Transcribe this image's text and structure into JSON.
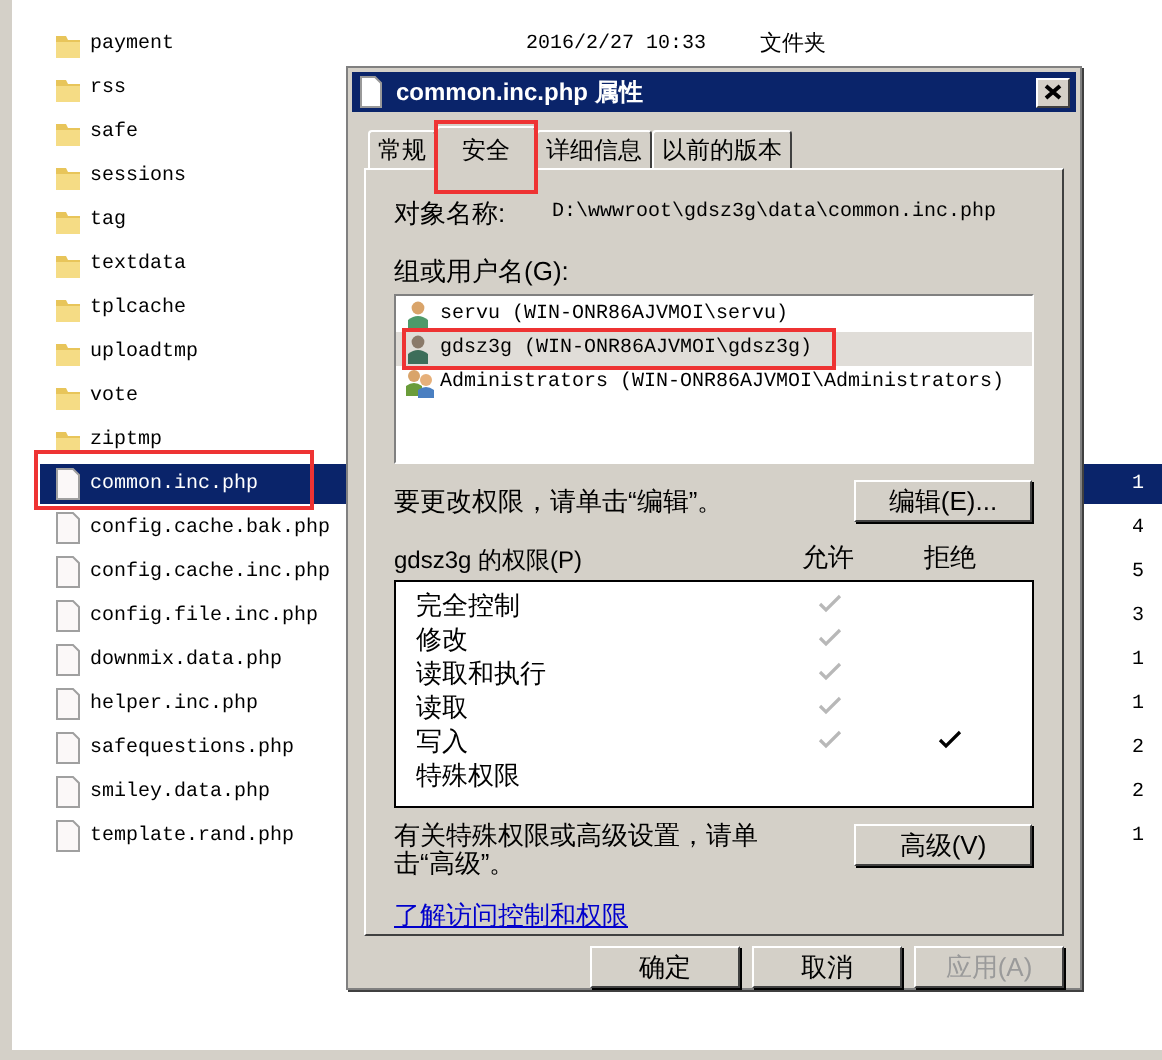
{
  "explorer": {
    "rows": [
      {
        "kind": "folder",
        "name": "payment",
        "date": "2016/2/27 10:33",
        "type": "文件夹",
        "selected": false
      },
      {
        "kind": "folder",
        "name": "rss",
        "selected": false
      },
      {
        "kind": "folder",
        "name": "safe",
        "selected": false
      },
      {
        "kind": "folder",
        "name": "sessions",
        "selected": false
      },
      {
        "kind": "folder",
        "name": "tag",
        "selected": false
      },
      {
        "kind": "folder",
        "name": "textdata",
        "selected": false
      },
      {
        "kind": "folder",
        "name": "tplcache",
        "selected": false
      },
      {
        "kind": "folder",
        "name": "uploadtmp",
        "selected": false
      },
      {
        "kind": "folder",
        "name": "vote",
        "selected": false
      },
      {
        "kind": "folder",
        "name": "ziptmp",
        "selected": false
      },
      {
        "kind": "file",
        "name": "common.inc.php",
        "size": "1",
        "selected": true,
        "highlighted": true
      },
      {
        "kind": "file",
        "name": "config.cache.bak.php",
        "size": "4",
        "selected": false
      },
      {
        "kind": "file",
        "name": "config.cache.inc.php",
        "size": "5",
        "selected": false
      },
      {
        "kind": "file",
        "name": "config.file.inc.php",
        "size": "3",
        "selected": false
      },
      {
        "kind": "file",
        "name": "downmix.data.php",
        "size": "1",
        "selected": false
      },
      {
        "kind": "file",
        "name": "helper.inc.php",
        "size": "1",
        "selected": false
      },
      {
        "kind": "file",
        "name": "safequestions.php",
        "size": "2",
        "selected": false
      },
      {
        "kind": "file",
        "name": "smiley.data.php",
        "size": "2",
        "selected": false
      },
      {
        "kind": "file",
        "name": "template.rand.php",
        "size": "1",
        "selected": false
      }
    ]
  },
  "dialog": {
    "title": "common.inc.php 属性",
    "tabs": [
      {
        "label": "常规",
        "selected": false
      },
      {
        "label": "安全",
        "selected": true,
        "highlighted": true
      },
      {
        "label": "详细信息",
        "selected": false
      },
      {
        "label": "以前的版本",
        "selected": false
      }
    ],
    "object_name_label": "对象名称:",
    "object_name": "D:\\wwwroot\\gdsz3g\\data\\common.inc.php",
    "users_label": "组或用户名(G):",
    "users": [
      {
        "kind": "user",
        "name": "servu (WIN-ONR86AJVMOI\\servu)",
        "selected": false
      },
      {
        "kind": "user",
        "name": "gdsz3g (WIN-ONR86AJVMOI\\gdsz3g)",
        "selected": true,
        "highlighted": true
      },
      {
        "kind": "group",
        "name": "Administrators (WIN-ONR86AJVMOI\\Administrators)",
        "selected": false
      }
    ],
    "edit_hint": "要更改权限，请单击“编辑”。",
    "edit_button": "编辑(E)...",
    "permissions_label": "gdsz3g 的权限(P)",
    "allow_header": "允许",
    "deny_header": "拒绝",
    "permissions": [
      {
        "name": "完全控制",
        "allow": true,
        "deny": false,
        "inherited": true
      },
      {
        "name": "修改",
        "allow": true,
        "deny": false,
        "inherited": true
      },
      {
        "name": "读取和执行",
        "allow": true,
        "deny": false,
        "inherited": true
      },
      {
        "name": "读取",
        "allow": true,
        "deny": false,
        "inherited": true
      },
      {
        "name": "写入",
        "allow": true,
        "deny": true,
        "inherited": true
      },
      {
        "name": "特殊权限",
        "allow": false,
        "deny": false
      }
    ],
    "advanced_hint": "有关特殊权限或高级设置，请单击“高级”。",
    "advanced_button": "高级(V)",
    "link": "了解访问控制和权限",
    "buttons": [
      {
        "label": "确定",
        "disabled": false
      },
      {
        "label": "取消",
        "disabled": false
      },
      {
        "label": "应用(A)",
        "disabled": true
      }
    ]
  }
}
